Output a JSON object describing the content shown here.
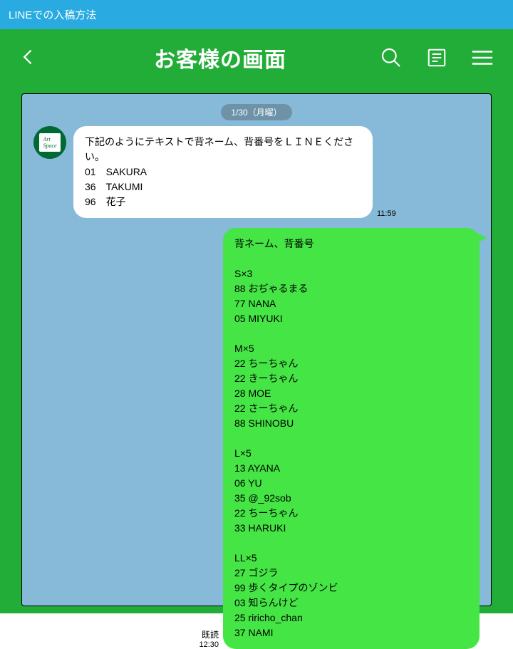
{
  "topbar": {
    "title": "LINEでの入稿方法"
  },
  "header": {
    "title": "お客様の画面"
  },
  "date_label": "1/30（月曜）",
  "incoming": {
    "avatar_label": "Art Space",
    "text": "下記のようにテキストで背ネーム、背番号をＬＩＮＥください。\n01　SAKURA\n36　TAKUMI\n96　花子",
    "time": "11:59"
  },
  "outgoing": {
    "read_label": "既読",
    "time": "12:30",
    "text": "背ネーム、背番号\n\nS×3\n88 おぢゃるまる\n77 NANA\n05 MIYUKI\n\nM×5\n22 ちーちゃん\n22 きーちゃん\n28 MOE\n22 さーちゃん\n88 SHINOBU\n\nL×5\n13 AYANA\n06 YU\n35 @_92sob\n22 ちーちゃん\n33 HARUKI\n\nLL×5\n27 ゴジラ\n99 歩くタイプのゾンビ\n03 知らんけど\n25 riricho_chan\n37 NAMI"
  }
}
